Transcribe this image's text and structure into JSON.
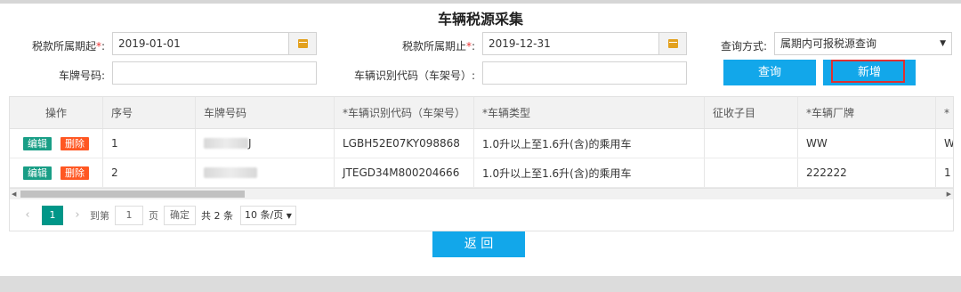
{
  "title": "车辆税源采集",
  "form": {
    "period_start": {
      "label": "税款所属期起",
      "required": "*",
      "colon": ":",
      "value": "2019-01-01"
    },
    "period_end": {
      "label": "税款所属期止",
      "required": "*",
      "colon": ":",
      "value": "2019-12-31"
    },
    "query_mode": {
      "label": "查询方式:",
      "value": "属期内可报税源查询"
    },
    "plate": {
      "label": "车牌号码:",
      "value": ""
    },
    "vin": {
      "label": "车辆识别代码（车架号）:",
      "value": ""
    }
  },
  "buttons": {
    "query": "查询",
    "add": "新增",
    "back": "返 回"
  },
  "table": {
    "headers": [
      "操作",
      "序号",
      "车牌号码",
      "*车辆识别代码（车架号）",
      "*车辆类型",
      "征收子目",
      "*车辆厂牌",
      "*"
    ],
    "rows": [
      {
        "edit": "编辑",
        "delete": "删除",
        "seq": "1",
        "plate_tail": "J",
        "vin": "LGBH52E07KY098868",
        "type": "1.0升以上至1.6升(含)的乘用车",
        "subitem": "",
        "brand": "WW",
        "extra": "W"
      },
      {
        "edit": "编辑",
        "delete": "删除",
        "seq": "2",
        "plate_tail": "",
        "vin": "JTEGD34M800204666",
        "type": "1.0升以上至1.6升(含)的乘用车",
        "subitem": "",
        "brand": "222222",
        "extra": "1"
      }
    ]
  },
  "pager": {
    "current": "1",
    "goto_label": "到第",
    "goto_value": "1",
    "page_unit": "页",
    "confirm": "确定",
    "total": "共 2 条",
    "page_size": "10 条/页"
  },
  "colors": {
    "accent": "#12a7ea",
    "edit": "#199e86",
    "delete": "#ff5722",
    "pager_active": "#009688",
    "highlight": "#e03030"
  },
  "icons": [
    "calendar-icon",
    "calendar-icon",
    "chevron-down-icon",
    "chevron-left-icon",
    "chevron-right-icon",
    "scroll-left-icon",
    "scroll-right-icon"
  ]
}
